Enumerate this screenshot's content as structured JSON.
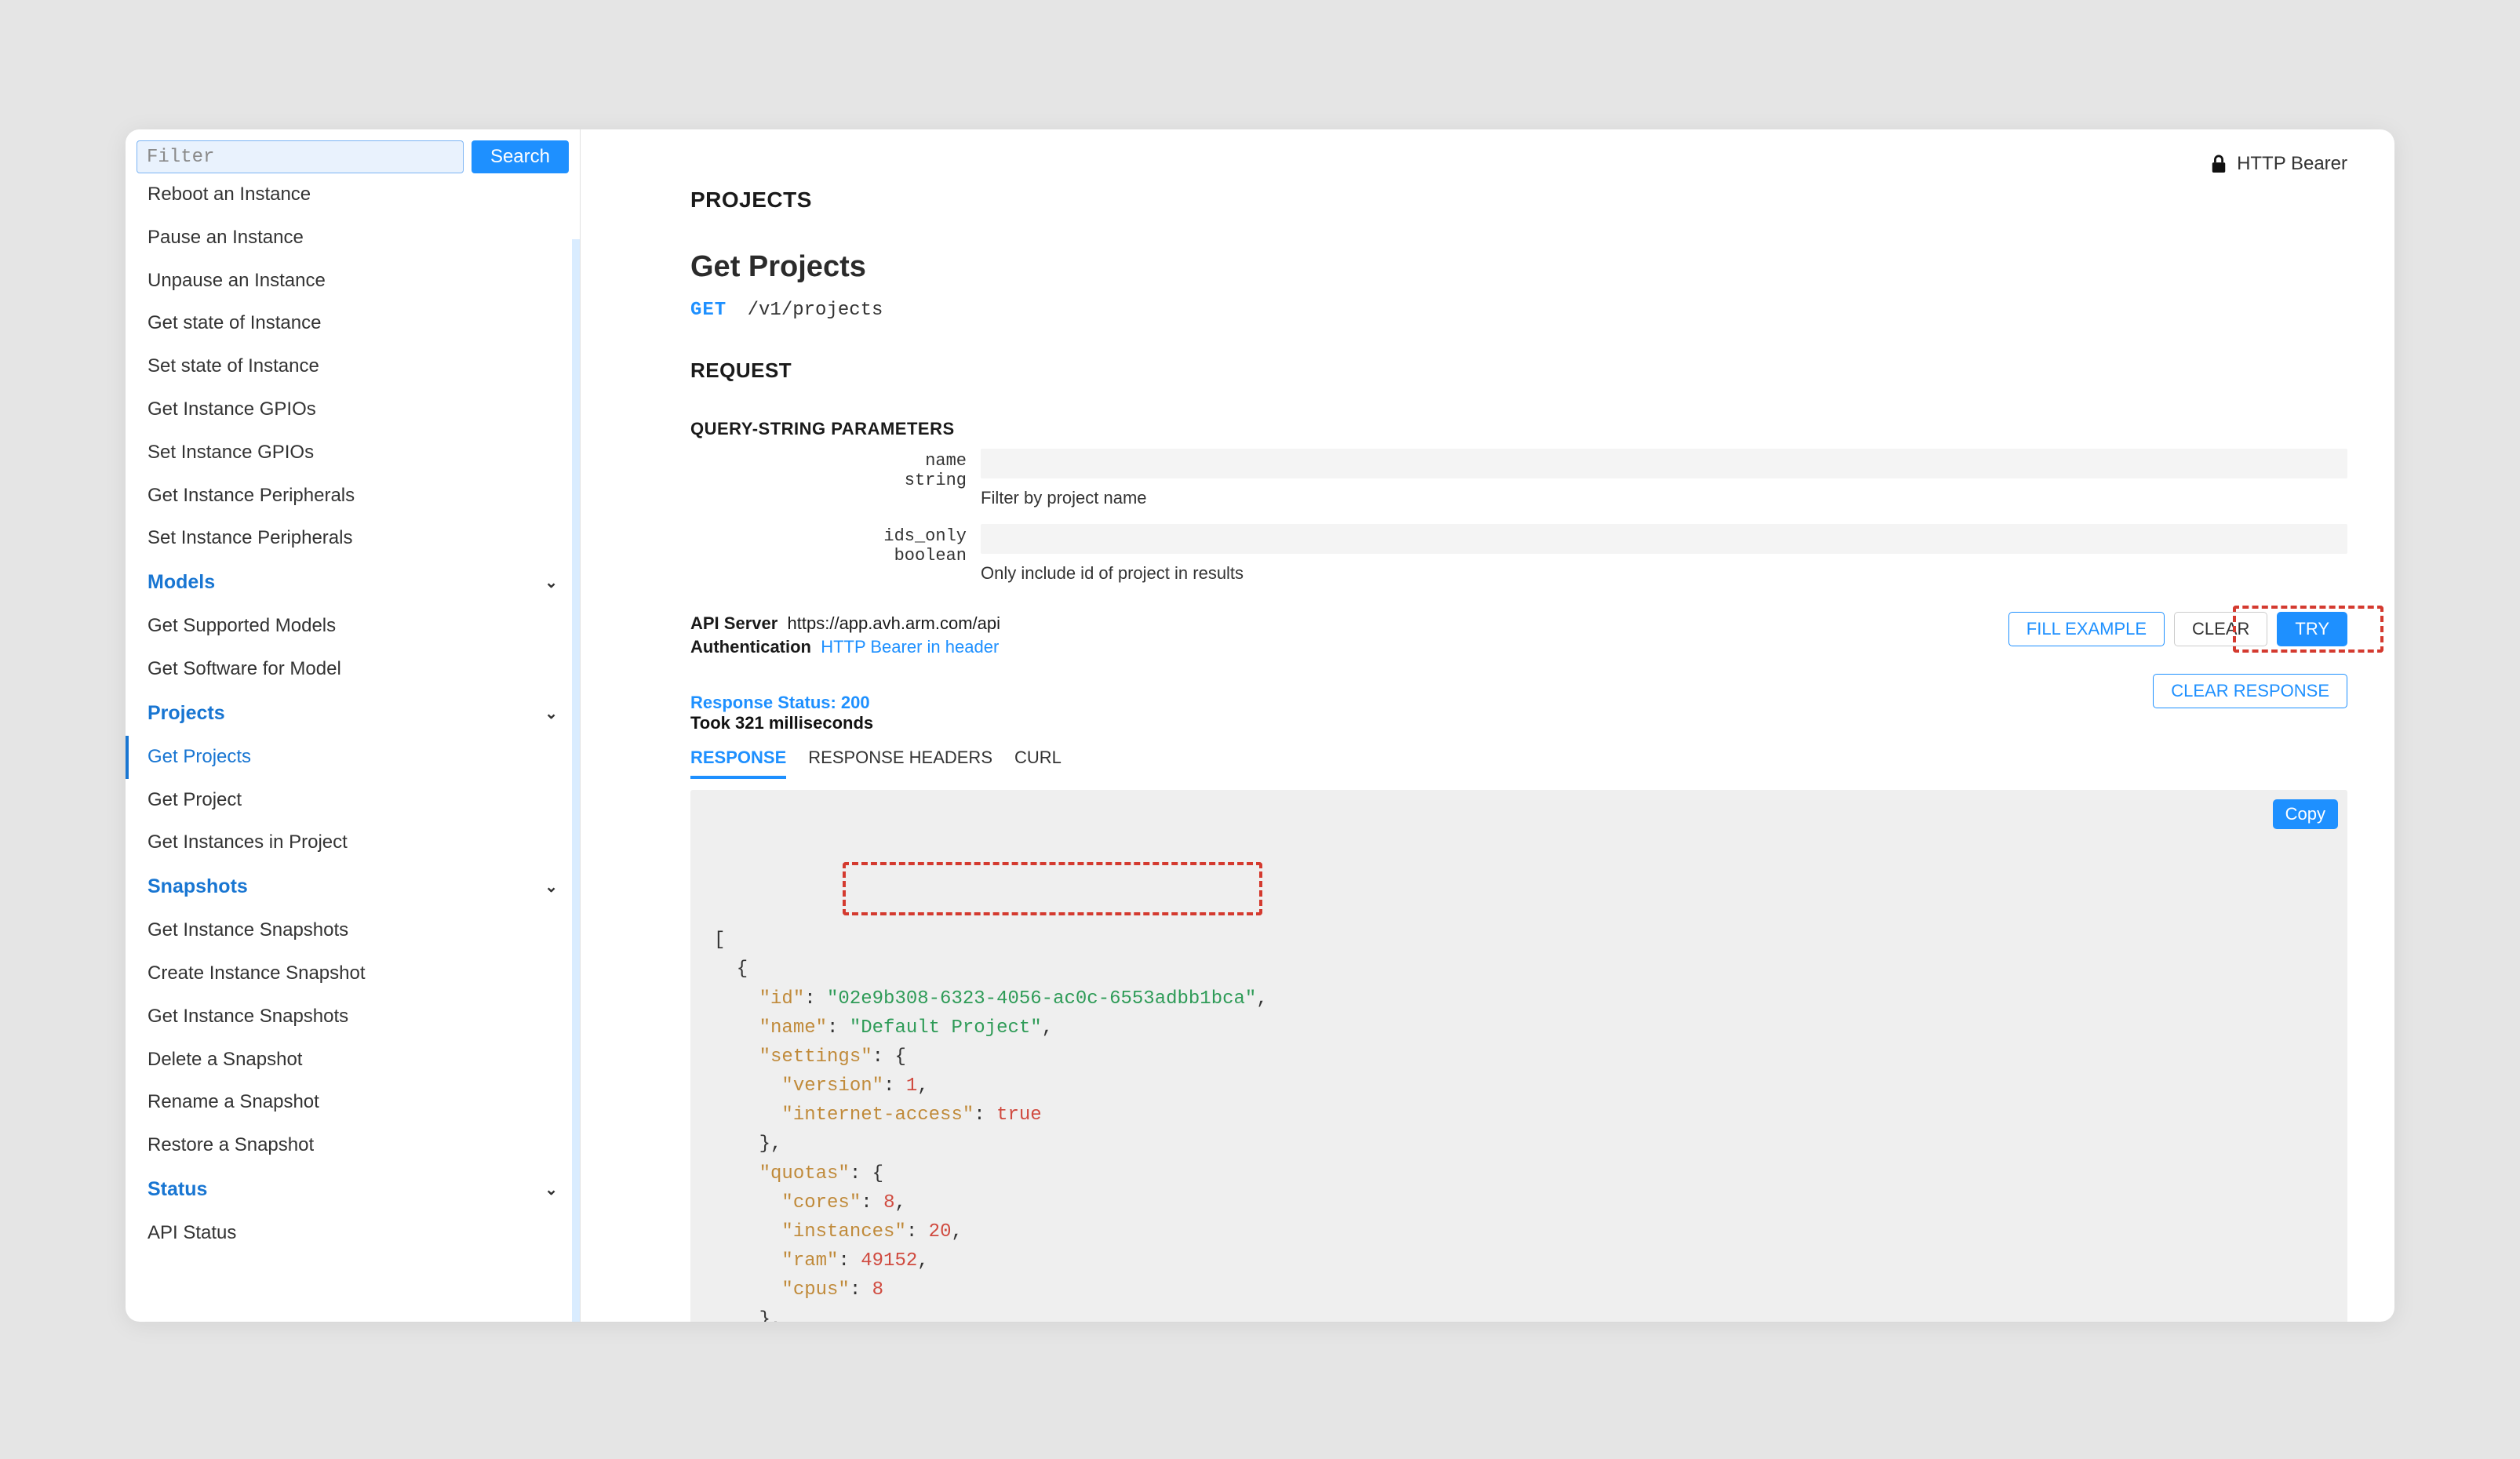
{
  "sidebar": {
    "filter_placeholder": "Filter",
    "search_label": "Search",
    "items_above": [
      "Reboot an Instance",
      "Pause an Instance",
      "Unpause an Instance",
      "Get state of Instance",
      "Set state of Instance",
      "Get Instance GPIOs",
      "Set Instance GPIOs",
      "Get Instance Peripherals",
      "Set Instance Peripherals"
    ],
    "sections": {
      "models": {
        "label": "Models",
        "items": [
          "Get Supported Models",
          "Get Software for Model"
        ]
      },
      "projects": {
        "label": "Projects",
        "items": [
          "Get Projects",
          "Get Project",
          "Get Instances in Project"
        ],
        "active_index": 0
      },
      "snapshots": {
        "label": "Snapshots",
        "items": [
          "Get Instance Snapshots",
          "Create Instance Snapshot",
          "Get Instance Snapshots",
          "Delete a Snapshot",
          "Rename a Snapshot",
          "Restore a Snapshot"
        ]
      },
      "status": {
        "label": "Status",
        "items": [
          "API Status"
        ]
      }
    }
  },
  "auth_badge": "HTTP Bearer",
  "breadcrumb": "PROJECTS",
  "endpoint": {
    "title": "Get Projects",
    "method": "GET",
    "path": "/v1/projects"
  },
  "request": {
    "heading": "REQUEST",
    "qsp_heading": "QUERY-STRING PARAMETERS",
    "params": [
      {
        "name": "name",
        "type": "string",
        "desc": "Filter by project name"
      },
      {
        "name": "ids_only",
        "type": "boolean",
        "desc": "Only include id of project in results"
      }
    ]
  },
  "server": {
    "api_server_label": "API Server",
    "api_server_value": "https://app.avh.arm.com/api",
    "auth_label": "Authentication",
    "auth_value": "HTTP Bearer in header"
  },
  "buttons": {
    "fill_example": "FILL EXAMPLE",
    "clear": "CLEAR",
    "try": "TRY",
    "clear_response": "CLEAR RESPONSE",
    "copy": "Copy"
  },
  "response": {
    "status_label": "Response Status: 200",
    "timing": "Took 321 milliseconds",
    "tabs": [
      "RESPONSE",
      "RESPONSE HEADERS",
      "CURL"
    ],
    "active_tab": 0,
    "json": {
      "id": "02e9b308-6323-4056-ac0c-6553adbb1bca",
      "name": "Default Project",
      "settings": {
        "version": 1,
        "internet-access": true
      },
      "quotas": {
        "cores": 8,
        "instances": 20,
        "ram": 49152,
        "cpus": 8
      },
      "quotasUsed": {}
    }
  }
}
